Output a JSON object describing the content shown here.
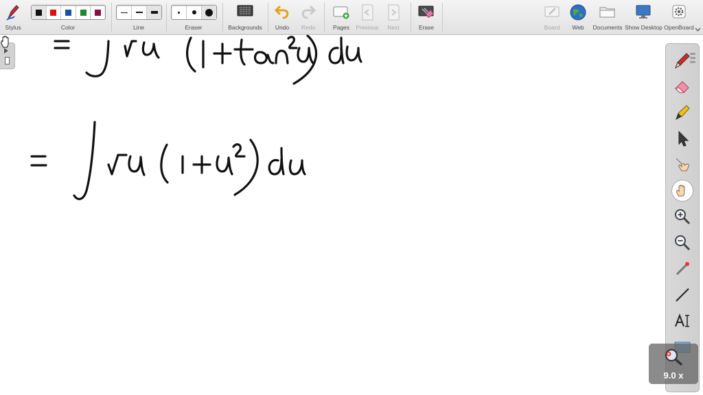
{
  "toolbar": {
    "stylus": "Stylus",
    "color": "Color",
    "line": "Line",
    "eraser": "Eraser",
    "backgrounds": "Backgrounds",
    "undo": "Undo",
    "redo": "Redo",
    "pages": "Pages",
    "previous": "Previous",
    "next": "Next",
    "erase": "Erase",
    "board": "Board",
    "web": "Web",
    "documents": "Documents",
    "show_desktop": "Show Desktop",
    "openboard": "OpenBoard"
  },
  "colors": {
    "swatches": [
      "#111111",
      "#e01010",
      "#1a4fa8",
      "#1a8a2a",
      "#8a1040"
    ],
    "ink": "#111111"
  },
  "zoom": {
    "label": "9.0 x"
  },
  "board": {
    "lines": [
      {
        "text": "= ∫ √u (1 + tan²u) du",
        "partially_visible": true
      },
      {
        "text": "= ∫ √u (1 + u²) du"
      }
    ]
  }
}
